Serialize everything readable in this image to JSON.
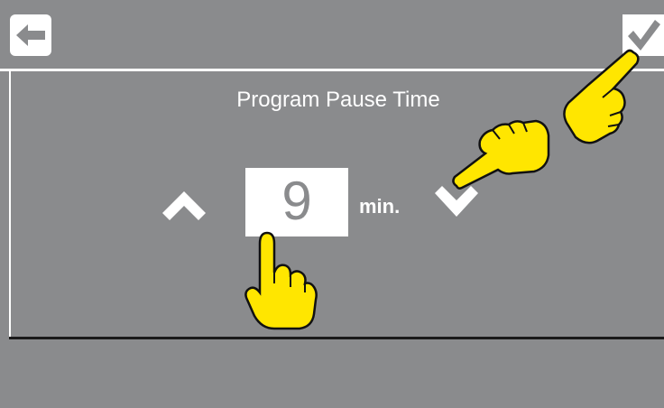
{
  "header": {
    "back_icon": "arrow-left-icon",
    "confirm_icon": "checkmark-icon"
  },
  "setting": {
    "title": "Program Pause Time",
    "value": "9",
    "unit": "min.",
    "increase_icon": "chevron-up-icon",
    "decrease_icon": "chevron-down-icon"
  },
  "annotations": {
    "pointer_icon": "pointing-hand-icon",
    "pointer_color": "#ffe600"
  },
  "colors": {
    "background": "#8a8b8d",
    "foreground": "#ffffff"
  }
}
